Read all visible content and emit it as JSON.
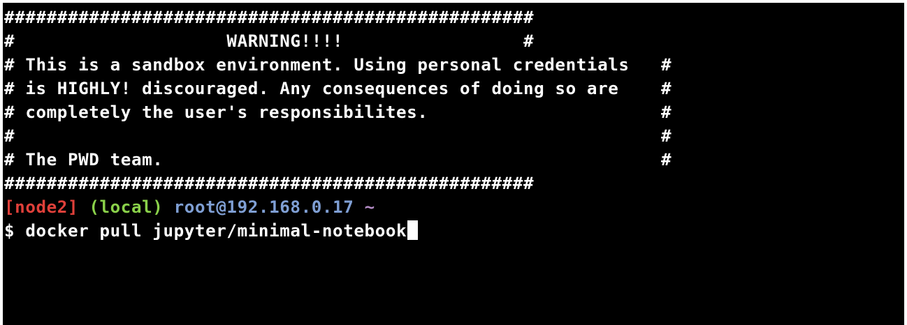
{
  "terminal": {
    "banner": [
      "##################################################",
      "#                    WARNING!!!!                 #",
      "# This is a sandbox environment. Using personal credentials   #",
      "# is HIGHLY! discouraged. Any consequences of doing so are    #",
      "# completely the user's responsibilites.                      #",
      "#                                                             #",
      "# The PWD team.                                               #",
      "##################################################"
    ],
    "prompt": {
      "node": "[node2]",
      "mode": "(local)",
      "user_host": "root@192.168.0.17",
      "path": "~",
      "symbol": "$",
      "command": "docker pull jupyter/minimal-notebook"
    },
    "colors": {
      "background": "#000000",
      "text": "#ffffff",
      "node": "#e0403a",
      "mode": "#8ad14a",
      "user_host": "#7f9fd4",
      "path": "#b48cc6"
    }
  }
}
